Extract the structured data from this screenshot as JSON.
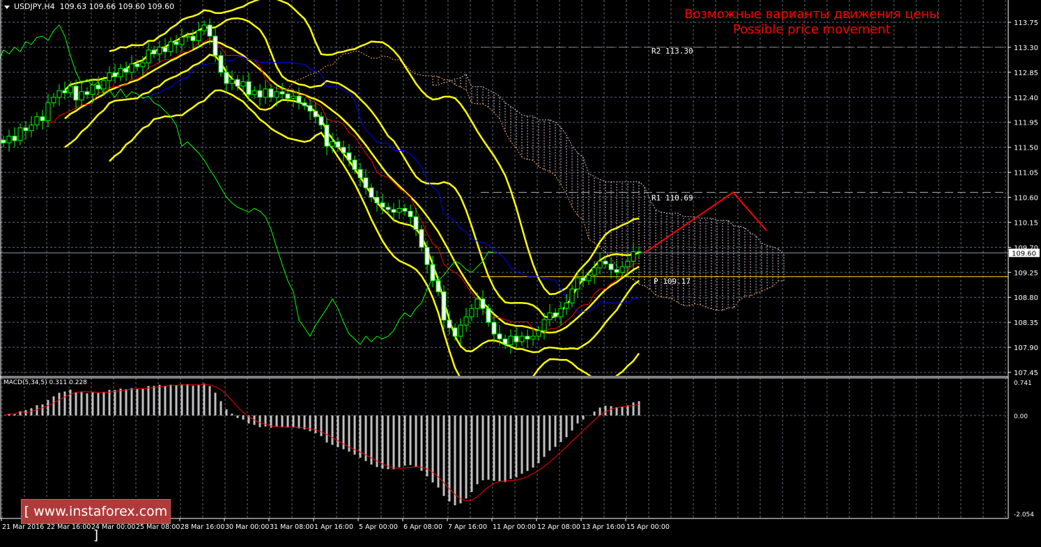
{
  "header": {
    "symbol_timeframe": "USDJPY,H4",
    "ohlc": "109.63 109.66 109.60 109.60"
  },
  "annotation": {
    "title_ru": "Возможные варианты движения цены",
    "title_en": "Possible price movement"
  },
  "logo": {
    "text": "[ www.instaforex.com ]"
  },
  "colors": {
    "background": "#000000",
    "bull_candle": "#000000",
    "bear_candle": "#ffffff",
    "wick": "#00ff00",
    "bollinger": "#ffff00",
    "tenkan": "#ff0000",
    "kijun": "#0000ff",
    "chikou": "#00ff00",
    "senkou_a": "#f4a460",
    "senkou_b": "#d8bfd8",
    "macd_hist": "#c0c0c0",
    "macd_signal": "#ff0000",
    "forecast": "#ff0000",
    "pivot": "#ffd700",
    "resistance": "#808080",
    "grid": "#5f6a78"
  },
  "chart_data": {
    "type": "candlestick",
    "symbol": "USDJPY",
    "timeframe": "H4",
    "grid": true,
    "ylim": [
      107.45,
      113.75
    ],
    "y_ticks": [
      "113.75",
      "113.30",
      "112.85",
      "112.40",
      "111.95",
      "111.50",
      "111.05",
      "110.60",
      "110.15",
      "109.70",
      "109.25",
      "108.80",
      "108.35",
      "107.90",
      "107.45"
    ],
    "current_price": "109.60",
    "x_ticks": [
      "21 Mar 2016",
      "22 Mar 16:00",
      "24 Mar 00:00",
      "25 Mar 08:00",
      "28 Mar 16:00",
      "30 Mar 00:00",
      "31 Mar 08:00",
      "1 Apr 16:00",
      "5 Apr 00:00",
      "6 Apr 08:00",
      "7 Apr 16:00",
      "11 Apr 00:00",
      "12 Apr 08:00",
      "13 Apr 16:00",
      "15 Apr 00:00"
    ],
    "closes": [
      111.58,
      111.7,
      111.62,
      111.85,
      111.8,
      111.9,
      112.05,
      111.98,
      112.3,
      112.4,
      112.52,
      112.48,
      112.6,
      112.35,
      112.5,
      112.45,
      112.62,
      112.55,
      112.7,
      112.84,
      112.77,
      112.92,
      112.85,
      113.0,
      112.95,
      113.02,
      113.25,
      113.18,
      113.3,
      113.22,
      113.4,
      113.35,
      113.48,
      113.5,
      113.42,
      113.6,
      113.7,
      113.5,
      113.15,
      112.85,
      112.65,
      112.72,
      112.6,
      112.68,
      112.45,
      112.52,
      112.4,
      112.55,
      112.4,
      112.5,
      112.46,
      112.38,
      112.42,
      112.3,
      112.25,
      112.15,
      112.05,
      111.9,
      111.52,
      111.6,
      111.5,
      111.4,
      111.27,
      111.1,
      110.95,
      110.77,
      110.6,
      110.5,
      110.42,
      110.38,
      110.33,
      110.4,
      110.35,
      110.25,
      110.02,
      109.7,
      109.39,
      109.1,
      108.9,
      108.39,
      108.25,
      108.1,
      108.3,
      108.45,
      108.6,
      108.77,
      108.6,
      108.35,
      108.14,
      108.05,
      107.95,
      108.1,
      108.0,
      108.1,
      108.05,
      108.1,
      108.2,
      108.4,
      108.52,
      108.45,
      108.6,
      108.7,
      108.95,
      109.15,
      109.1,
      109.2,
      109.33,
      109.45,
      109.4,
      109.3,
      109.25,
      109.35,
      109.45,
      109.62,
      109.6
    ],
    "levels": [
      {
        "label": "R2 113.30",
        "value": 113.3,
        "style": "dashed"
      },
      {
        "label": "R1 110.69",
        "value": 110.69,
        "style": "dashed"
      },
      {
        "label": "P 109.17",
        "value": 109.17,
        "style": "solid"
      }
    ],
    "forecast_path": [
      109.6,
      110.69,
      110.0
    ],
    "indicators": [
      "Bollinger Bands",
      "Ichimoku Kinko Hyo"
    ],
    "macd": {
      "label": "MACD(5,34,5) 0.311 0.228",
      "ylim": [
        -2.054,
        0.741
      ],
      "y_ticks": [
        "0.741",
        "0.00",
        "-2.054"
      ]
    }
  }
}
